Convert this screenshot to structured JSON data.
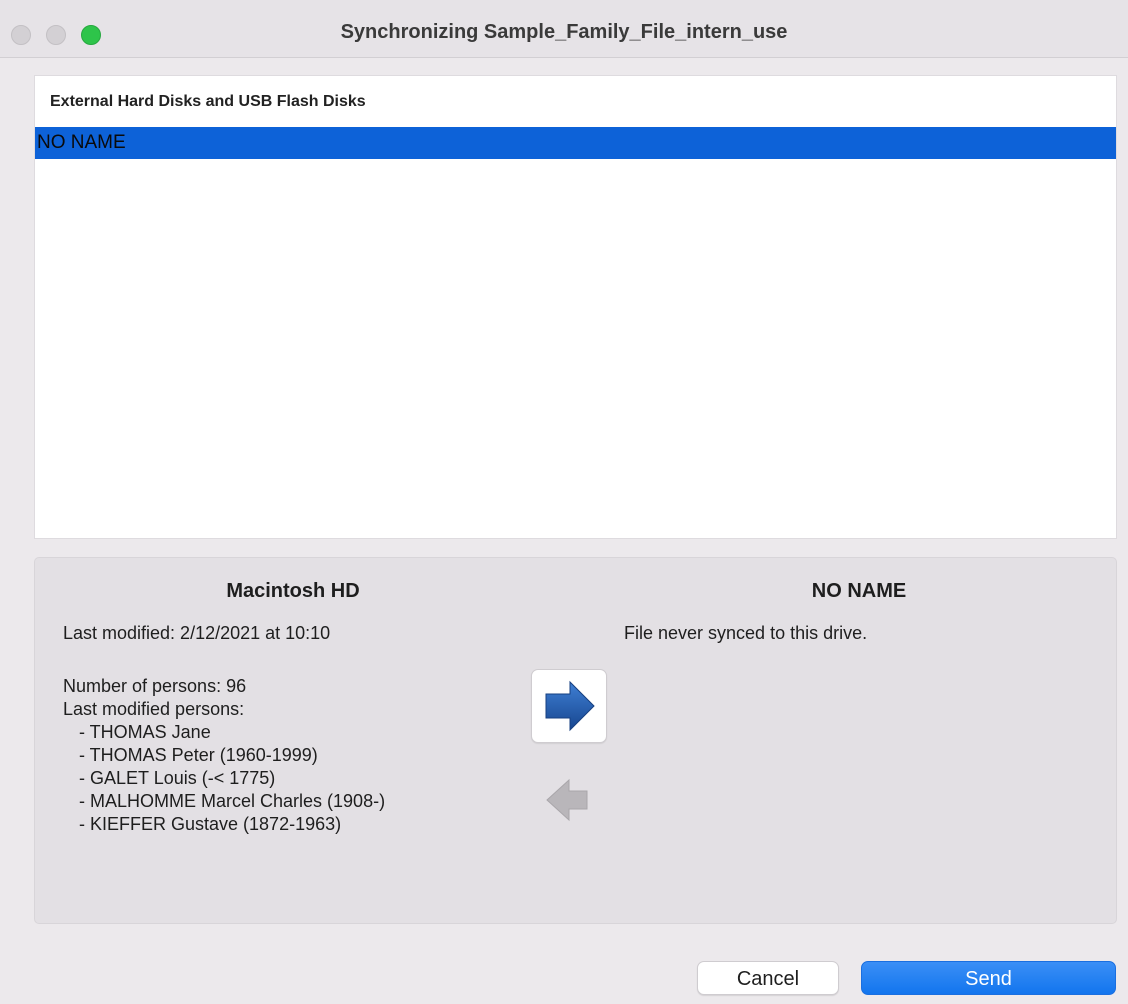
{
  "window": {
    "title": "Synchronizing Sample_Family_File_intern_use"
  },
  "disk_list": {
    "header": "External Hard Disks and USB Flash Disks",
    "items": [
      {
        "label": "NO NAME",
        "selected": true
      }
    ],
    "selection_color": "#0d62d8"
  },
  "source": {
    "name": "Macintosh HD",
    "last_modified": "Last modified: 2/12/2021 at 10:10",
    "persons_count": "Number of persons: 96",
    "last_modified_persons_label": "Last modified persons:",
    "persons": [
      "- THOMAS Jane",
      "- THOMAS Peter (1960-1999)",
      "- GALET Louis (-< 1775)",
      "- MALHOMME Marcel Charles (1908-)",
      "- KIEFFER Gustave (1872-1963)"
    ]
  },
  "destination": {
    "name": "NO NAME",
    "status": "File never synced to this drive."
  },
  "sync_controls": {
    "forward_icon": "right-arrow-icon",
    "backward_icon": "left-arrow-icon",
    "forward_color": "#1f5aa8",
    "backward_enabled": false
  },
  "buttons": {
    "cancel": "Cancel",
    "send": "Send",
    "accent": "#1275ee"
  }
}
